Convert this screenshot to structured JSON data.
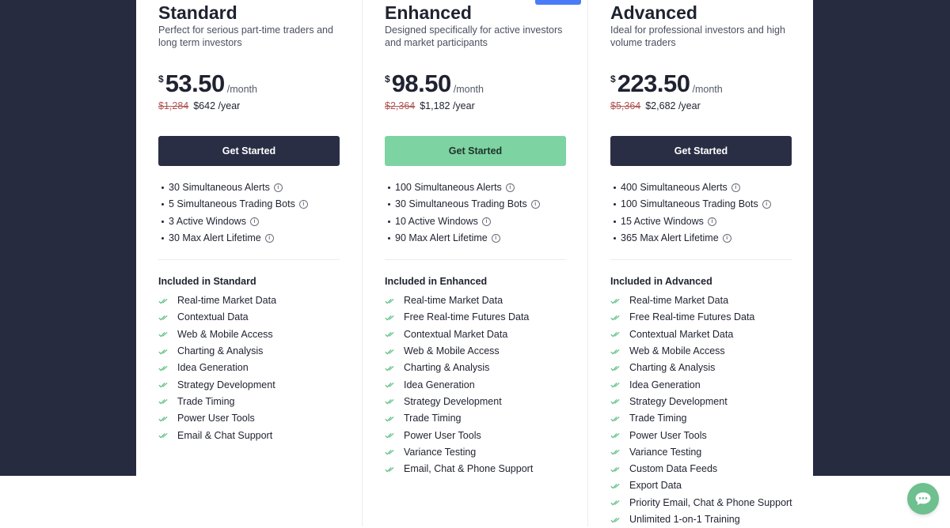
{
  "colors": {
    "dark_bg": "#262b40",
    "dark_button": "#2a2e45",
    "green_button": "#7dd3a1",
    "check": "#5dbf86",
    "badge": "#4a7cf7",
    "chat": "#6ec08e"
  },
  "info_glyph": "i",
  "plans": [
    {
      "name": "Standard",
      "description": "Perfect for serious part-time traders and long term investors",
      "currency": "$",
      "price": "53.50",
      "period": "/month",
      "old_yearly": "$1,284",
      "yearly": "$642 /year",
      "cta": "Get Started",
      "limits": [
        "30 Simultaneous Alerts",
        "5 Simultaneous Trading Bots",
        "3 Active Windows",
        "30 Max Alert Lifetime"
      ],
      "included_title": "Included in Standard",
      "features": [
        "Real-time Market Data",
        "Contextual Data",
        "Web & Mobile Access",
        "Charting & Analysis",
        "Idea Generation",
        "Strategy Development",
        "Trade Timing",
        "Power User Tools",
        "Email & Chat Support"
      ]
    },
    {
      "name": "Enhanced",
      "description": "Designed specifically for active investors and market participants",
      "currency": "$",
      "price": "98.50",
      "period": "/month",
      "old_yearly": "$2,364",
      "yearly": "$1,182 /year",
      "cta": "Get Started",
      "limits": [
        "100 Simultaneous Alerts",
        "30 Simultaneous Trading Bots",
        "10 Active Windows",
        "90 Max Alert Lifetime"
      ],
      "included_title": "Included in Enhanced",
      "features": [
        "Real-time Market Data",
        "Free Real-time Futures Data",
        "Contextual Market Data",
        "Web & Mobile Access",
        "Charting & Analysis",
        "Idea Generation",
        "Strategy Development",
        "Trade Timing",
        "Power User Tools",
        "Variance Testing",
        "Email, Chat & Phone Support"
      ]
    },
    {
      "name": "Advanced",
      "description": "Ideal for professional investors and high volume traders",
      "currency": "$",
      "price": "223.50",
      "period": "/month",
      "old_yearly": "$5,364",
      "yearly": "$2,682 /year",
      "cta": "Get Started",
      "limits": [
        "400 Simultaneous Alerts",
        "100 Simultaneous Trading Bots",
        "15 Active Windows",
        "365 Max Alert Lifetime"
      ],
      "included_title": "Included in Advanced",
      "features": [
        "Real-time Market Data",
        "Free Real-time Futures Data",
        "Contextual Market Data",
        "Web & Mobile Access",
        "Charting & Analysis",
        "Idea Generation",
        "Strategy Development",
        "Trade Timing",
        "Power User Tools",
        "Variance Testing",
        "Custom Data Feeds",
        "Export Data",
        "Priority Email, Chat & Phone Support",
        "Unlimited 1-on-1 Training"
      ]
    }
  ]
}
